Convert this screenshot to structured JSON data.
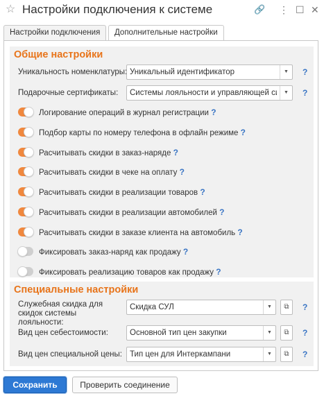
{
  "window": {
    "title": "Настройки подключения к системе",
    "icons": [
      "star-icon",
      "link-icon",
      "more-icon",
      "maximize-icon",
      "close-icon"
    ],
    "star_glyph": "☆",
    "link_glyph": "🔗",
    "more_glyph": "⋮",
    "maximize_glyph": "☐",
    "close_glyph": "✕"
  },
  "tabs": [
    {
      "label": "Настройки подключения",
      "active": false
    },
    {
      "label": "Дополнительные настройки",
      "active": true
    }
  ],
  "general": {
    "title": "Общие настройки",
    "uniqueness": {
      "label": "Уникальность номенклатуры:",
      "value": "Уникальный идентификатор"
    },
    "gift_cards": {
      "label": "Подарочные сертификаты:",
      "value": "Системы лояльности и управляющей сис"
    },
    "toggles": [
      {
        "label": "Логирование операций в журнал регистрации",
        "on": true
      },
      {
        "label": "Подбор карты по номеру телефона в офлайн режиме",
        "on": true
      },
      {
        "label": "Расчитывать скидки в заказ-наряде",
        "on": true
      },
      {
        "label": "Расчитывать скидки в чеке на оплату",
        "on": true
      },
      {
        "label": "Расчитывать скидки в реализации товаров",
        "on": true
      },
      {
        "label": "Расчитывать скидки в реализации автомобилей",
        "on": true
      },
      {
        "label": "Расчитывать скидки в заказе клиента на автомобиль",
        "on": true
      },
      {
        "label": "Фиксировать заказ-наряд как продажу",
        "on": false
      },
      {
        "label": "Фиксировать реализацию товаров как продажу",
        "on": false
      }
    ]
  },
  "special": {
    "title": "Специальные настройки",
    "service_discount": {
      "label": "Служебная скидка для скидок системы лояльности:",
      "value": "Скидка СУЛ"
    },
    "cost_price_type": {
      "label": "Вид цен себестоимости:",
      "value": "Основной тип цен закупки"
    },
    "special_price_type": {
      "label": "Вид цен специальной цены:",
      "value": "Тип цен для Интеркампани"
    }
  },
  "help_glyph": "?",
  "dropdown_glyph": "▼",
  "open_glyph": "⧉",
  "footer": {
    "save_label": "Сохранить",
    "check_label": "Проверить соединение"
  },
  "colors": {
    "accent_orange": "#f0883e",
    "group_title": "#e8741a",
    "primary_button": "#2d79d4",
    "help": "#3a75c4"
  }
}
